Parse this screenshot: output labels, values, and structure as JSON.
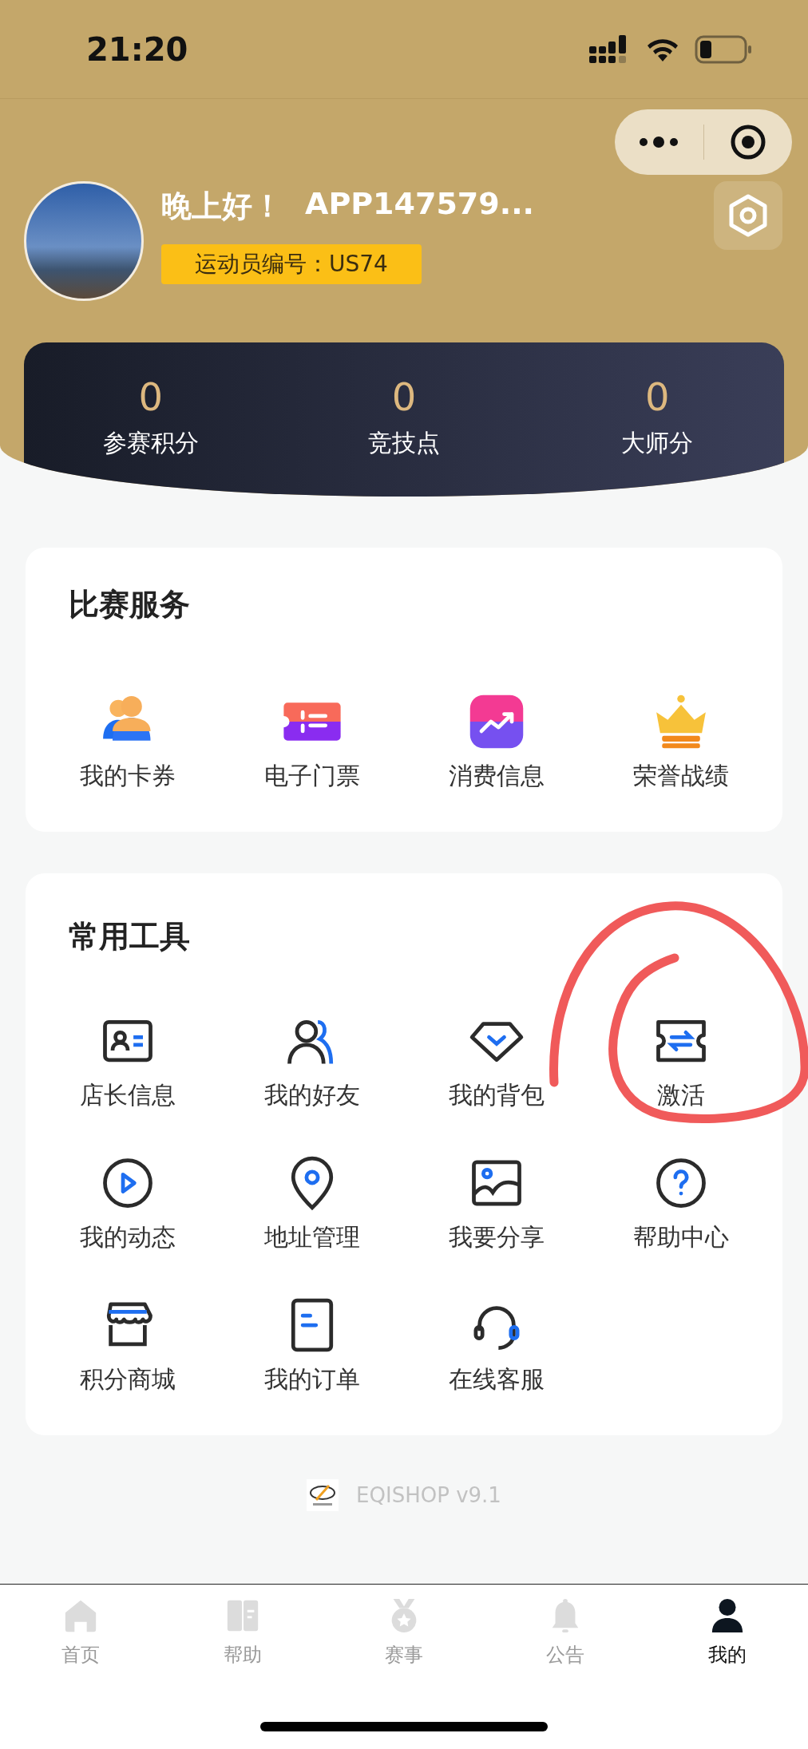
{
  "status_bar": {
    "time": "21:20"
  },
  "profile": {
    "greeting": "晚上好！",
    "username": "APP147579...",
    "athlete_id": "运动员编号：US74"
  },
  "stats": [
    {
      "value": "0",
      "label": "参赛积分"
    },
    {
      "value": "0",
      "label": "竞技点"
    },
    {
      "value": "0",
      "label": "大师分"
    }
  ],
  "sections": [
    {
      "title": "比赛服务",
      "items": [
        {
          "label": "我的卡券",
          "kind": "users"
        },
        {
          "label": "电子门票",
          "kind": "ticket"
        },
        {
          "label": "消费信息",
          "kind": "chart"
        },
        {
          "label": "荣誉战绩",
          "kind": "crown"
        }
      ]
    },
    {
      "title": "常用工具",
      "items": [
        {
          "label": "店长信息",
          "kind": "idcard"
        },
        {
          "label": "我的好友",
          "kind": "friends"
        },
        {
          "label": "我的背包",
          "kind": "bag"
        },
        {
          "label": "激活",
          "kind": "exchange"
        },
        {
          "label": "我的动态",
          "kind": "play"
        },
        {
          "label": "地址管理",
          "kind": "pin"
        },
        {
          "label": "我要分享",
          "kind": "image"
        },
        {
          "label": "帮助中心",
          "kind": "help"
        },
        {
          "label": "积分商城",
          "kind": "store"
        },
        {
          "label": "我的订单",
          "kind": "document"
        },
        {
          "label": "在线客服",
          "kind": "headset"
        }
      ]
    }
  ],
  "footer": {
    "text": "EQISHOP v9.1"
  },
  "tabs": [
    {
      "label": "首页",
      "kind": "home",
      "selected": false
    },
    {
      "label": "帮助",
      "kind": "book",
      "selected": false
    },
    {
      "label": "赛事",
      "kind": "medal",
      "selected": false
    },
    {
      "label": "公告",
      "kind": "bell",
      "selected": false
    },
    {
      "label": "我的",
      "kind": "person",
      "selected": true
    }
  ]
}
